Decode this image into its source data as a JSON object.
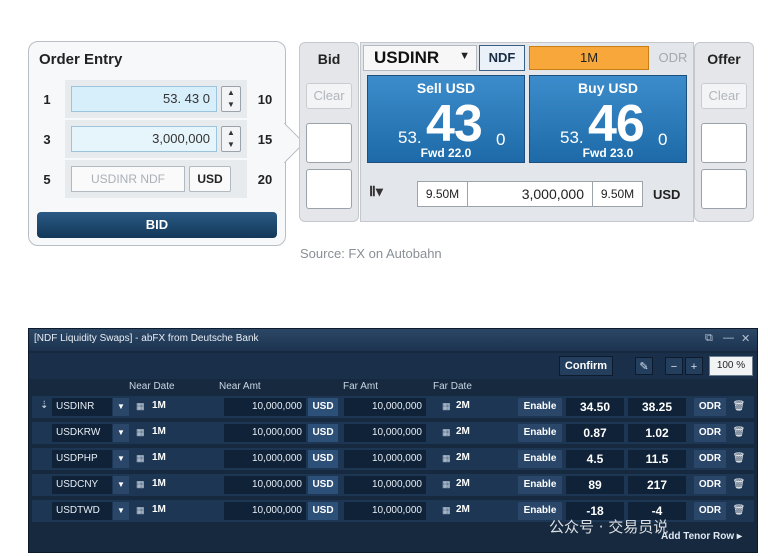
{
  "order_entry": {
    "title": "Order Entry",
    "rows": [
      {
        "left": "1",
        "value": "53. 43 0",
        "right": "10"
      },
      {
        "left": "3",
        "value": "3,000,000",
        "right": "15"
      },
      {
        "left": "5",
        "ccy_placeholder": "USDINR NDF",
        "ccy_button": "USD",
        "right": "20"
      }
    ],
    "bid_label": "BID"
  },
  "ticket": {
    "bid_header": "Bid",
    "offer_header": "Offer",
    "clear_label": "Clear",
    "pair": "USDINR",
    "pair_arrow": "▼",
    "ndf_label": "NDF",
    "tenor": "1M",
    "odr_label": "ODR",
    "sell": {
      "title": "Sell USD",
      "prefix": "53.",
      "big": "43",
      "suffix": "0",
      "fwd": "Fwd 22.0"
    },
    "buy": {
      "title": "Buy USD",
      "prefix": "53.",
      "big": "46",
      "suffix": "0",
      "fwd": "Fwd 23.0"
    },
    "amount_left": "9.50M",
    "amount": "3,000,000",
    "amount_right": "9.50M",
    "amount_ccy": "USD",
    "tool_icon": "Ⅱ▾"
  },
  "source_caption": "Source: FX on Autobahn",
  "ndf_window": {
    "title": "[NDF Liquidity Swaps] - abFX from Deutsche Bank",
    "confirm_label": "Confirm",
    "zoom": "100 %",
    "headers": {
      "near_date": "Near Date",
      "near_amt": "Near Amt",
      "far_amt": "Far Amt",
      "far_date": "Far Date"
    },
    "rows": [
      {
        "symbol": "USDINR",
        "near_tenor": "1M",
        "near_amt": "10,000,000",
        "ccy": "USD",
        "far_amt": "10,000,000",
        "far_tenor": "2M",
        "enable": "Enable",
        "bid": "34.50",
        "offer": "38.25",
        "odr": "ODR"
      },
      {
        "symbol": "USDKRW",
        "near_tenor": "1M",
        "near_amt": "10,000,000",
        "ccy": "USD",
        "far_amt": "10,000,000",
        "far_tenor": "2M",
        "enable": "Enable",
        "bid": "0.87",
        "offer": "1.02",
        "odr": "ODR"
      },
      {
        "symbol": "USDPHP",
        "near_tenor": "1M",
        "near_amt": "10,000,000",
        "ccy": "USD",
        "far_amt": "10,000,000",
        "far_tenor": "2M",
        "enable": "Enable",
        "bid": "4.5",
        "offer": "11.5",
        "odr": "ODR"
      },
      {
        "symbol": "USDCNY",
        "near_tenor": "1M",
        "near_amt": "10,000,000",
        "ccy": "USD",
        "far_amt": "10,000,000",
        "far_tenor": "2M",
        "enable": "Enable",
        "bid": "89",
        "offer": "217",
        "odr": "ODR"
      },
      {
        "symbol": "USDTWD",
        "near_tenor": "1M",
        "near_amt": "10,000,000",
        "ccy": "USD",
        "far_amt": "10,000,000",
        "far_tenor": "2M",
        "enable": "Enable",
        "bid": "-18",
        "offer": "-4",
        "odr": "ODR"
      }
    ],
    "add_row_label": "Add Tenor Row ▸",
    "watermark": "公众号 · 交易员说"
  }
}
